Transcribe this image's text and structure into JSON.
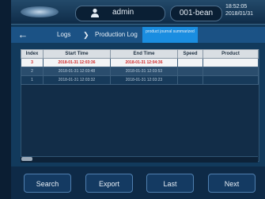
{
  "header": {
    "user": "admin",
    "product": "001-bean",
    "time": "18:52:05",
    "date": "2018/01/31"
  },
  "nav": {
    "back_icon": "back-arrow-icon",
    "crumbs": [
      "Logs",
      "Production Log"
    ],
    "active_tab": "product journal summarized"
  },
  "table": {
    "columns": [
      "Index",
      "Start Time",
      "End Time",
      "Speed",
      "Product"
    ],
    "rows": [
      [
        "3",
        "2018-01-31 12:03:36",
        "2018-01-31 12:04:36",
        "",
        ""
      ],
      [
        "2",
        "2018-01-31 12:03:48",
        "2018-01-31 12:03:53",
        "",
        ""
      ],
      [
        "1",
        "2018-01-31 12:03:32",
        "2018-01-31 12:03:23",
        "",
        ""
      ]
    ],
    "selected_index": 0
  },
  "buttons": {
    "search": "Search",
    "export": "Export",
    "last": "Last",
    "next": "Next"
  },
  "colors": {
    "accent": "#1a8de0",
    "selected_text": "#d02a2a",
    "background": "#0b1e33"
  }
}
